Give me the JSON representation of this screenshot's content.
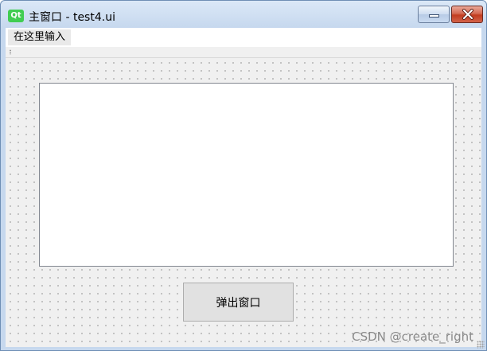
{
  "window": {
    "logo_text": "Qt",
    "title": "主窗口 - test4.ui",
    "minimize_icon": "minimize-icon",
    "close_icon": "close-icon"
  },
  "menubar": {
    "items": [
      {
        "label": "在这里输入"
      }
    ]
  },
  "central": {
    "text_edit_value": "",
    "popup_button_label": "弹出窗口"
  },
  "watermark": "CSDN @create_right",
  "colors": {
    "qt_logo": "#41cd52",
    "close_button": "#c23c20",
    "client_background": "#f0f0f0"
  }
}
